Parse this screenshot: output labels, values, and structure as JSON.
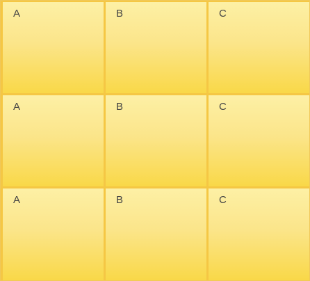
{
  "grid": {
    "rows": [
      {
        "cells": [
          {
            "label": "A"
          },
          {
            "label": "B"
          },
          {
            "label": "C"
          }
        ]
      },
      {
        "cells": [
          {
            "label": "A"
          },
          {
            "label": "B"
          },
          {
            "label": "C"
          }
        ]
      },
      {
        "cells": [
          {
            "label": "A"
          },
          {
            "label": "B"
          },
          {
            "label": "C"
          }
        ]
      }
    ]
  },
  "colors": {
    "tile_top": "#fdf0a5",
    "tile_bottom": "#f9d848",
    "grid_lines": "#f5c744",
    "text": "#444444"
  }
}
